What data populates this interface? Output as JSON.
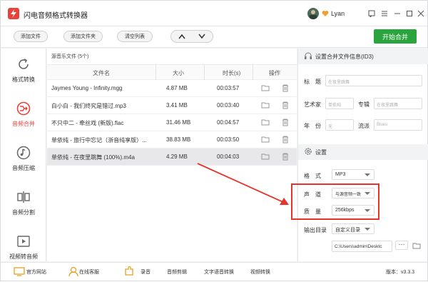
{
  "app": {
    "title": "闪电音频格式转换器",
    "user": "Lyan"
  },
  "toolbar": {
    "add_file": "添加文件",
    "add_folder": "添加文件夹",
    "clear_list": "清空列表",
    "start_merge": "开始合并"
  },
  "sidebar": {
    "items": [
      {
        "label": "格式转换",
        "icon": "refresh-icon"
      },
      {
        "label": "音频合并",
        "icon": "merge-icon",
        "active": true
      },
      {
        "label": "音频压缩",
        "icon": "compress-icon"
      },
      {
        "label": "音频分割",
        "icon": "split-icon"
      },
      {
        "label": "视频转音频",
        "icon": "video-icon"
      }
    ]
  },
  "list": {
    "header": "源音乐文件 (5个)",
    "columns": {
      "name": "文件名",
      "size": "大小",
      "duration": "时长(s)",
      "action": "操作"
    },
    "rows": [
      {
        "name": "Jaymes Young - Infinity.mgg",
        "size": "4.87 MB",
        "duration": "00:03:57"
      },
      {
        "name": "白小白 - 我们终究是错过.mp3",
        "size": "3.41 MB",
        "duration": "00:03:40"
      },
      {
        "name": "不只中二 - 牵丝戏 (新版).flac",
        "size": "31.46 MB",
        "duration": "00:04:57"
      },
      {
        "name": "单依纯 - 旅行中忘记（浙音纯享版）...",
        "size": "38.83 MB",
        "duration": "00:03:50"
      },
      {
        "name": "单依纯 - 在夜里跳舞 (100%).m4a",
        "size": "4.29 MB",
        "duration": "00:04:03",
        "selected": true
      }
    ]
  },
  "meta": {
    "section_title": "设置合并文件信息(ID3)",
    "title_label": "标　题",
    "title_value": "在夜里跳舞",
    "artist_label": "艺术家",
    "artist_value": "单依纯",
    "album_label": "专辑",
    "album_value": "在夜里跳舞",
    "year_label": "年　份",
    "year_value": "无",
    "genre_label": "流派",
    "genre_value": "Blues"
  },
  "settings": {
    "section_title": "设置",
    "format_label": "格　式",
    "format_value": "MP3",
    "channel_label": "声　道",
    "channel_value": "与源音频一致",
    "quality_label": "质　量",
    "quality_value": "256kbps",
    "output_label": "输出目录",
    "output_value": "自定义目录",
    "path_value": "C:\\Users\\admin\\Desktc"
  },
  "bottom": {
    "website": "官方网站",
    "service": "在线客服",
    "record": "录音",
    "cut": "音频剪辑",
    "tts": "文字语音转换",
    "video": "视频转换",
    "version": "版本：v3.3.3"
  },
  "colors": {
    "accent_red": "#e8423a",
    "start_green": "#2aa53d",
    "annotation_red": "#e8332b"
  }
}
